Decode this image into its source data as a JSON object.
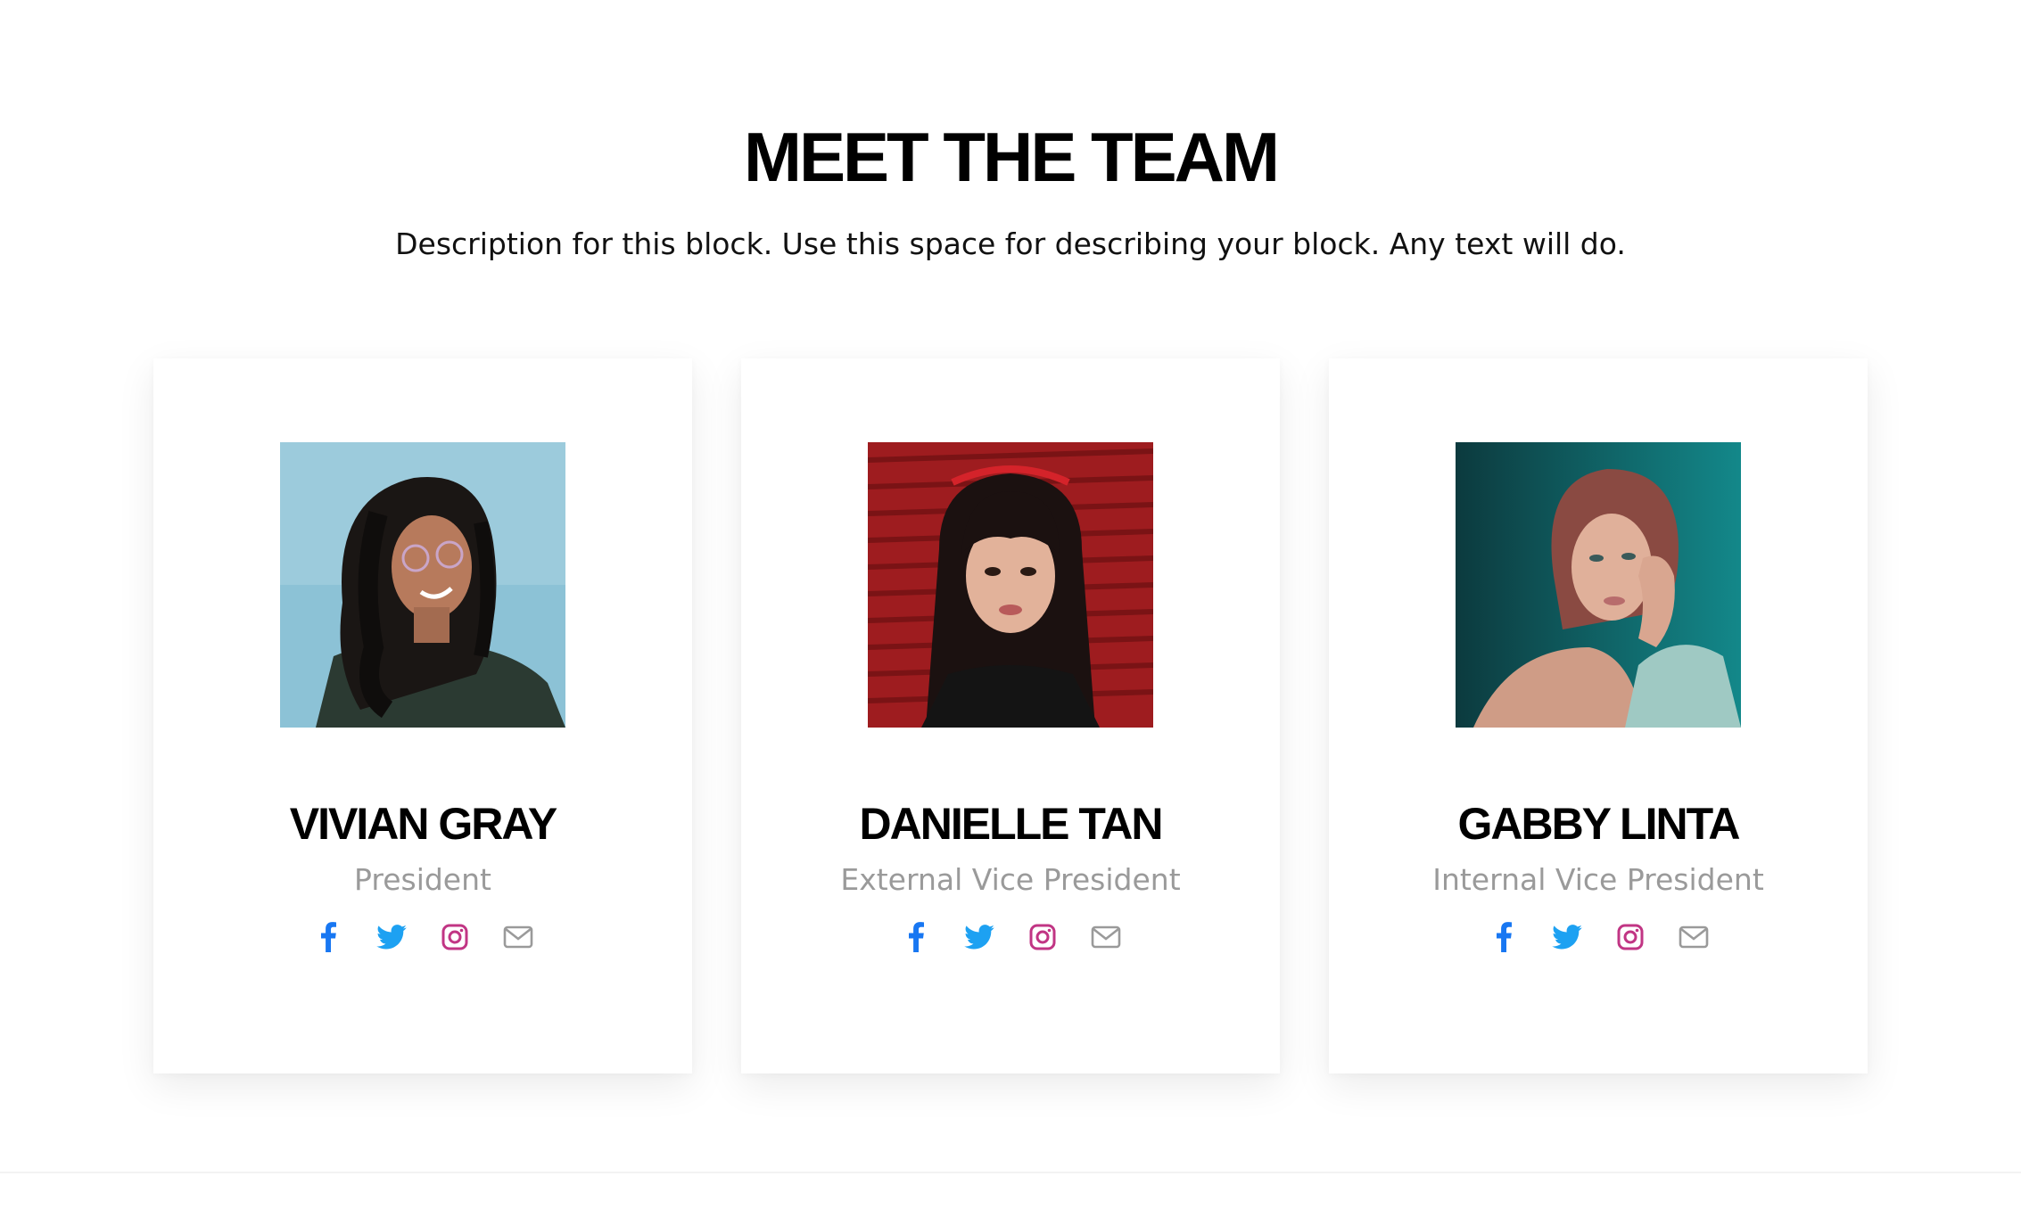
{
  "section": {
    "title": "MEET THE TEAM",
    "description": "Description for this block. Use this space for describing your block. Any text will do."
  },
  "colors": {
    "facebook": "#1877f2",
    "twitter": "#1da1f2",
    "instagram": "#c13584",
    "email": "#9a9a9a",
    "role_text": "#9a9a9a"
  },
  "members": [
    {
      "name": "VIVIAN GRAY",
      "role": "President",
      "photo": "portrait-woman-curly-hair-glasses",
      "socials": [
        "facebook-icon",
        "twitter-icon",
        "instagram-icon",
        "email-icon"
      ]
    },
    {
      "name": "DANIELLE TAN",
      "role": "External Vice President",
      "photo": "portrait-woman-bangs-red-background",
      "socials": [
        "facebook-icon",
        "twitter-icon",
        "instagram-icon",
        "email-icon"
      ]
    },
    {
      "name": "GABBY LINTA",
      "role": "Internal Vice President",
      "photo": "portrait-woman-teal-background",
      "socials": [
        "facebook-icon",
        "twitter-icon",
        "instagram-icon",
        "email-icon"
      ]
    }
  ]
}
